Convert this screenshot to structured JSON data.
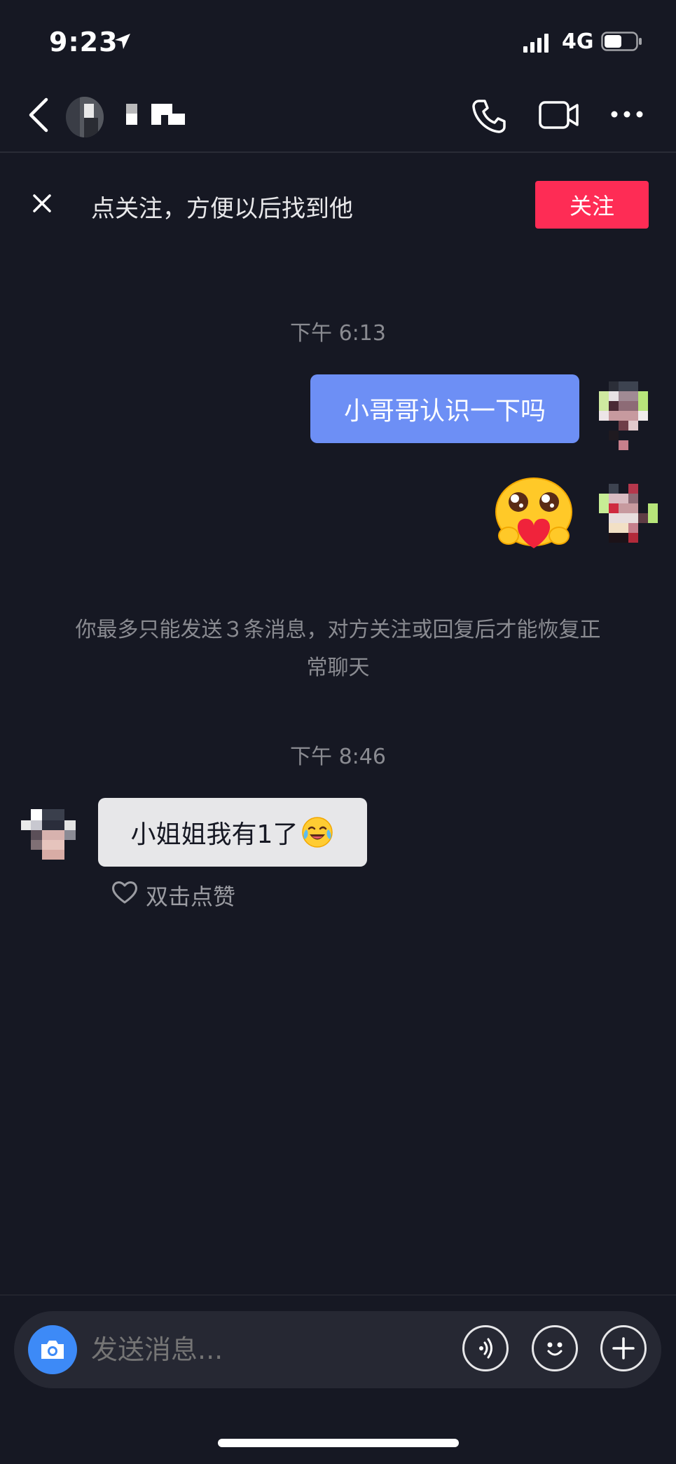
{
  "status_bar": {
    "time": "9:23",
    "network": "4G"
  },
  "nav": {
    "icons": [
      "back-icon",
      "phone-icon",
      "video-icon",
      "more-icon"
    ]
  },
  "banner": {
    "text": "点关注，方便以后找到他",
    "follow_label": "关注",
    "follow_color": "#fe2c55"
  },
  "messages": {
    "time_1": "下午 6:13",
    "outgoing_text": "小哥哥认识一下吗",
    "outgoing_bubble_color": "#6d8ff5",
    "notice": "你最多只能发送３条消息，对方关注或回复后才能恢复正常聊天",
    "time_2": "下午 8:46",
    "incoming_text": "小姐姐我有1了",
    "like_label": "双击点赞"
  },
  "input": {
    "placeholder": "发送消息...",
    "icons": [
      "camera-icon",
      "voice-icon",
      "emoji-icon",
      "plus-icon"
    ]
  }
}
